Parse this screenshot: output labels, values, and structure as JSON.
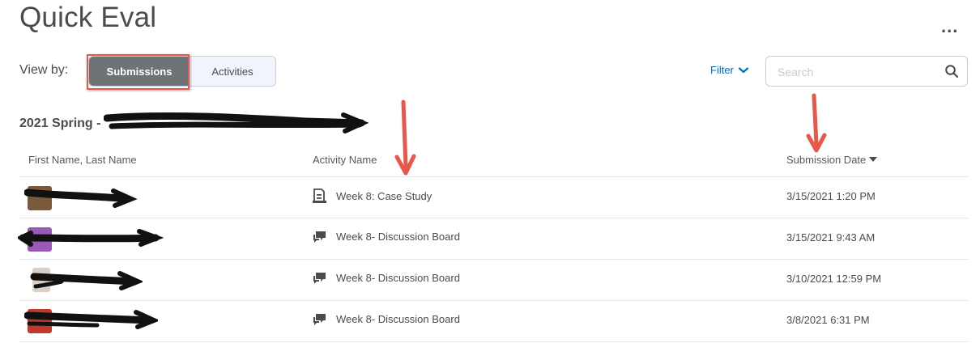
{
  "page": {
    "title": "Quick Eval",
    "more_label": "..."
  },
  "view_by": {
    "label": "View by:",
    "submissions": "Submissions",
    "activities": "Activities"
  },
  "filter": {
    "label": "Filter"
  },
  "search": {
    "placeholder": "Search"
  },
  "course": {
    "title": "2021 Spring -"
  },
  "table": {
    "headers": {
      "name": "First Name, Last Name",
      "activity": "Activity Name",
      "date": "Submission Date"
    },
    "rows": [
      {
        "activity": "Week 8: Case Study",
        "activity_icon": "assignment-icon",
        "date": "3/15/2021 1:20 PM",
        "avatar_color": "#7a5a3a"
      },
      {
        "activity": "Week 8- Discussion Board",
        "activity_icon": "discussion-icon",
        "date": "3/15/2021 9:43 AM",
        "avatar_color": "#9b59b6"
      },
      {
        "activity": "Week 8- Discussion Board",
        "activity_icon": "discussion-icon",
        "date": "3/10/2021 12:59 PM",
        "avatar_color": "#d9cfc6"
      },
      {
        "activity": "Week 8- Discussion Board",
        "activity_icon": "discussion-icon",
        "date": "3/8/2021 6:31 PM",
        "avatar_color": "#c0392b"
      }
    ]
  },
  "colors": {
    "accent": "#006fbf",
    "annotation_red": "#e8574b",
    "selected_segment": "#6e7376"
  }
}
